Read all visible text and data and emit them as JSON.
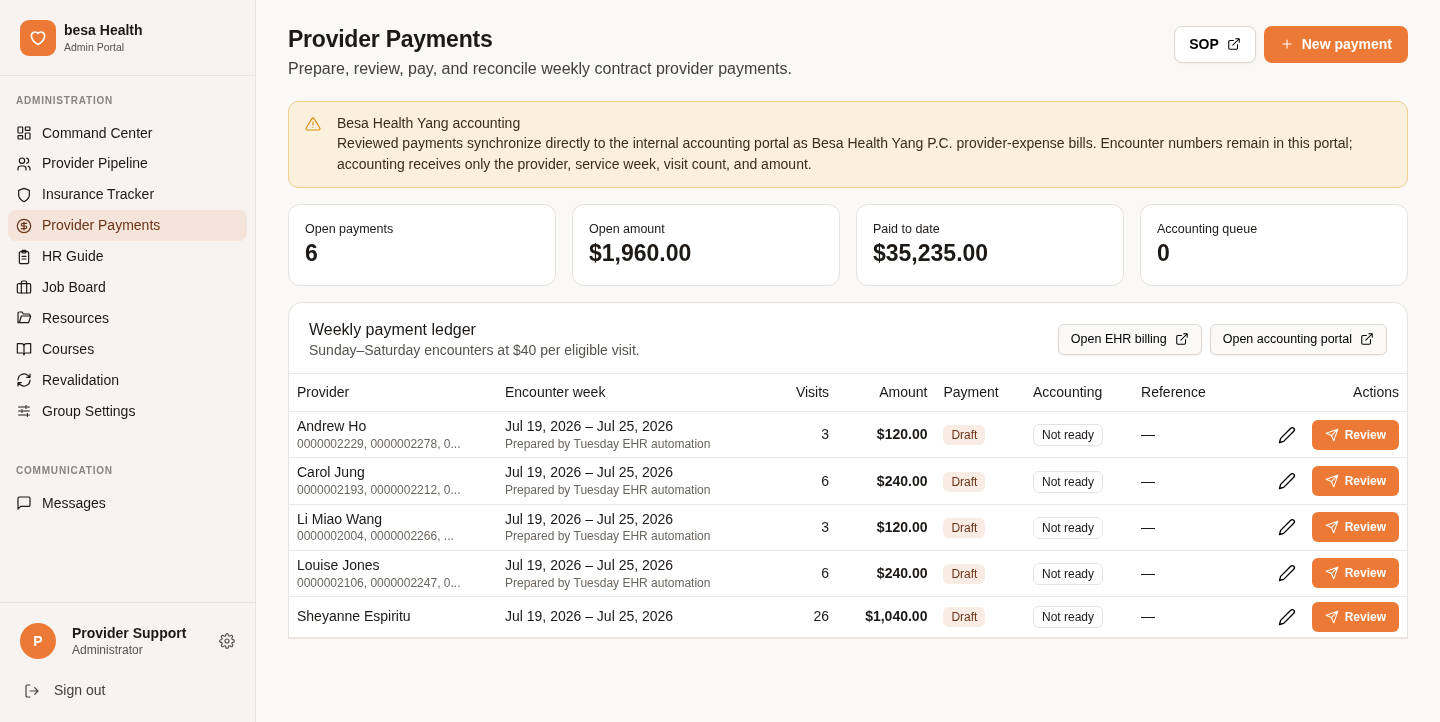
{
  "brand": {
    "name": "besa Health",
    "subtitle": "Admin Portal"
  },
  "sidebar": {
    "sections": [
      {
        "heading": "ADMINISTRATION",
        "items": [
          {
            "label": "Command Center",
            "selected": false
          },
          {
            "label": "Provider Pipeline",
            "selected": false
          },
          {
            "label": "Insurance Tracker",
            "selected": false
          },
          {
            "label": "Provider Payments",
            "selected": true
          },
          {
            "label": "HR Guide",
            "selected": false
          },
          {
            "label": "Job Board",
            "selected": false
          },
          {
            "label": "Resources",
            "selected": false
          },
          {
            "label": "Courses",
            "selected": false
          },
          {
            "label": "Revalidation",
            "selected": false
          },
          {
            "label": "Group Settings",
            "selected": false
          }
        ]
      },
      {
        "heading": "COMMUNICATION",
        "items": [
          {
            "label": "Messages",
            "selected": false
          }
        ]
      }
    ],
    "user": {
      "initial": "P",
      "name": "Provider Support",
      "role": "Administrator"
    },
    "sign_out": "Sign out"
  },
  "page": {
    "title": "Provider Payments",
    "subtitle": "Prepare, review, pay, and reconcile weekly contract provider payments.",
    "buttons": [
      {
        "label": "SOP",
        "kind": "external"
      },
      {
        "label": "New payment",
        "kind": "primary"
      }
    ]
  },
  "alert": {
    "title": "Besa Health Yang accounting",
    "text": "Reviewed payments synchronize directly to the internal accounting portal as Besa Health Yang P.C. provider-expense bills. Encounter numbers remain in this portal; accounting receives only the provider, service week, visit count, and amount."
  },
  "stats": [
    {
      "label": "Open payments",
      "value": "6"
    },
    {
      "label": "Open amount",
      "value": "$1,960.00"
    },
    {
      "label": "Paid to date",
      "value": "$35,235.00"
    },
    {
      "label": "Accounting queue",
      "value": "0"
    }
  ],
  "ledger": {
    "title": "Weekly payment ledger",
    "subtitle": "Sunday–Saturday encounters at $40 per eligible visit.",
    "buttons": [
      "Open EHR billing",
      "Open accounting portal"
    ],
    "table": {
      "columns": [
        "Provider",
        "Encounter week",
        "Visits",
        "Amount",
        "Payment",
        "Accounting",
        "Reference",
        "Actions"
      ],
      "rows": [
        {
          "provider": "Andrew Ho",
          "encounters": "0000002229, 0000002278, 0...",
          "week": "Jul 19, 2026 – Jul 25, 2026",
          "prepared": "Prepared by Tuesday EHR automation",
          "visits": "3",
          "amount": "$120.00",
          "payment": "Draft",
          "accounting": "Not ready",
          "reference": "—",
          "action": "Review"
        },
        {
          "provider": "Carol Jung",
          "encounters": "0000002193, 0000002212, 0...",
          "week": "Jul 19, 2026 – Jul 25, 2026",
          "prepared": "Prepared by Tuesday EHR automation",
          "visits": "6",
          "amount": "$240.00",
          "payment": "Draft",
          "accounting": "Not ready",
          "reference": "—",
          "action": "Review"
        },
        {
          "provider": "Li Miao Wang",
          "encounters": "0000002004, 0000002266, ...",
          "week": "Jul 19, 2026 – Jul 25, 2026",
          "prepared": "Prepared by Tuesday EHR automation",
          "visits": "3",
          "amount": "$120.00",
          "payment": "Draft",
          "accounting": "Not ready",
          "reference": "—",
          "action": "Review"
        },
        {
          "provider": "Louise Jones",
          "encounters": "0000002106, 0000002247, 0...",
          "week": "Jul 19, 2026 – Jul 25, 2026",
          "prepared": "Prepared by Tuesday EHR automation",
          "visits": "6",
          "amount": "$240.00",
          "payment": "Draft",
          "accounting": "Not ready",
          "reference": "—",
          "action": "Review"
        },
        {
          "provider": "Sheyanne Espiritu",
          "week": "Jul 19, 2026 – Jul 25, 2026",
          "visits": "26",
          "amount": "$1,040.00",
          "payment": "Draft",
          "accounting": "Not ready",
          "reference": "—",
          "action": "Review"
        }
      ]
    }
  }
}
